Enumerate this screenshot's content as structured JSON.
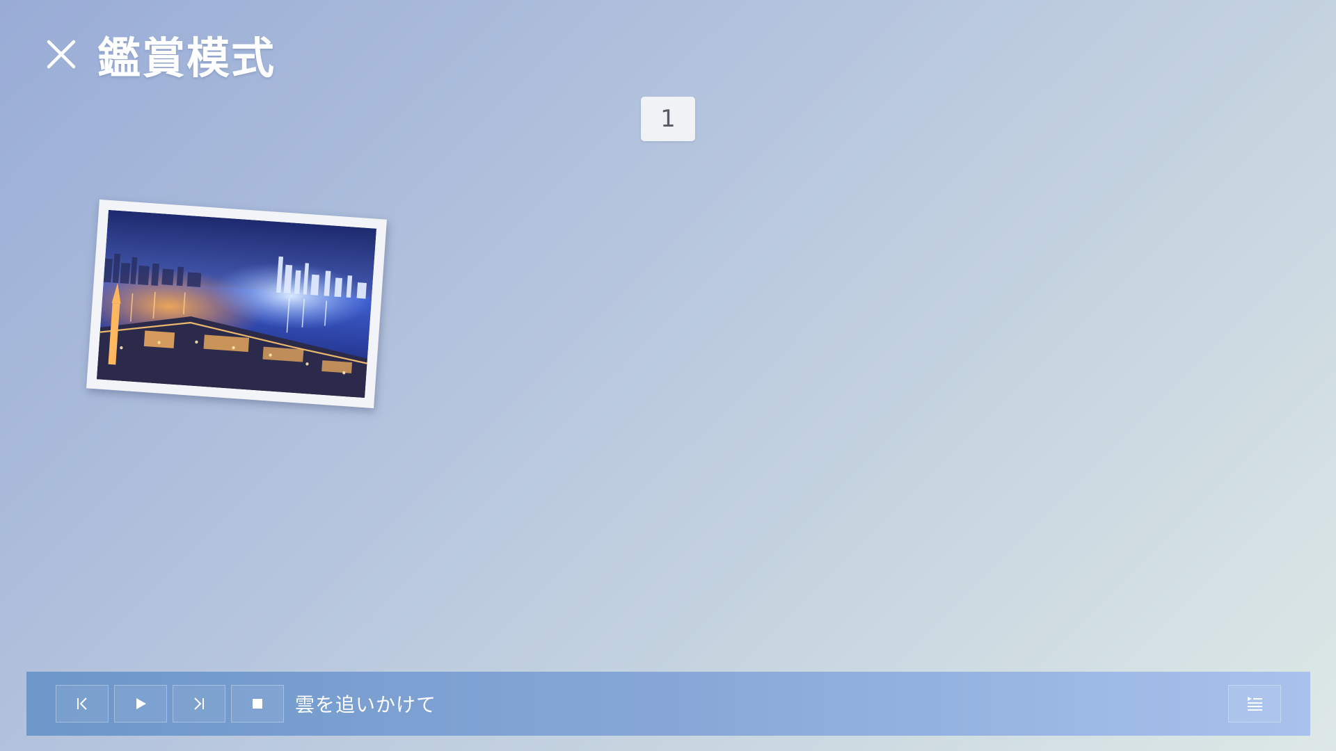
{
  "header": {
    "title": "鑑賞模式",
    "close_icon": "close-icon"
  },
  "page_counter": {
    "value": "1"
  },
  "photo": {
    "description_icon": "night-city-photo"
  },
  "player": {
    "track_title": "雲を追いかけて",
    "controls": [
      {
        "name": "previous-track-button",
        "icon": "skip-previous-icon"
      },
      {
        "name": "play-button",
        "icon": "play-icon"
      },
      {
        "name": "next-track-button",
        "icon": "skip-next-icon"
      },
      {
        "name": "stop-button",
        "icon": "stop-icon"
      }
    ],
    "playlist_icon": "playlist-icon"
  },
  "colors": {
    "bar_start": "#6d96c9",
    "bar_end": "#a8c2ec",
    "background_start": "#99acd6",
    "background_end": "#dde8e6"
  }
}
